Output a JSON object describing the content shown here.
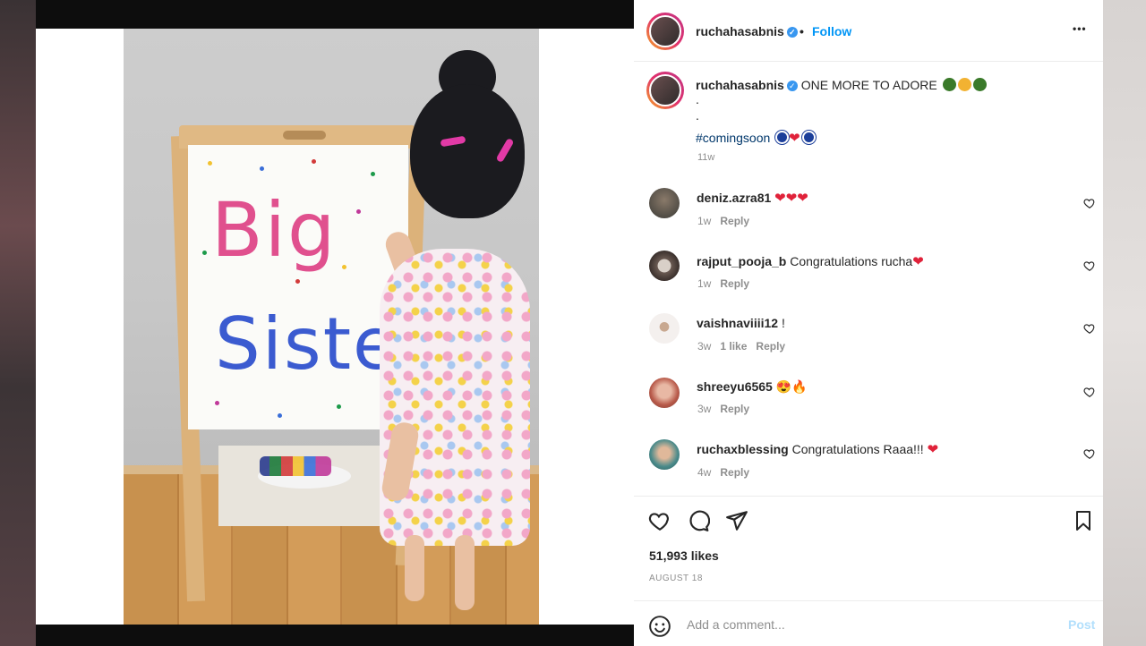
{
  "post": {
    "username": "ruchahasabnis",
    "follow_label": "Follow",
    "separator": "•",
    "more_label": "•••"
  },
  "caption": {
    "username": "ruchahasabnis",
    "text": "ONE MORE TO ADORE",
    "line2": ".",
    "line3": ".",
    "hashtag": "#comingsoon",
    "time": "11w"
  },
  "comments": [
    {
      "username": "deniz.azra81",
      "text": "",
      "emoji": "❤❤❤",
      "time": "1w",
      "likes": "",
      "reply": "Reply"
    },
    {
      "username": "rajput_pooja_b",
      "text": "Congratulations rucha",
      "emoji": "❤",
      "time": "1w",
      "likes": "",
      "reply": "Reply"
    },
    {
      "username": "vaishnaviiii12",
      "text": "!",
      "emoji": "",
      "time": "3w",
      "likes": "1 like",
      "reply": "Reply"
    },
    {
      "username": "shreeyu6565",
      "text": "",
      "emoji": "😍🔥",
      "time": "3w",
      "likes": "",
      "reply": "Reply"
    },
    {
      "username": "ruchaxblessing",
      "text": "Congratulations Raaa!!!",
      "emoji": "❤",
      "time": "4w",
      "likes": "",
      "reply": "Reply"
    }
  ],
  "stats": {
    "likes": "51,993 likes",
    "date": "AUGUST 18"
  },
  "add_comment": {
    "placeholder": "Add a comment...",
    "post_label": "Post"
  },
  "photo": {
    "board_line1": "Big",
    "board_line2": "Sister"
  },
  "colors": {
    "accent": "#0095f6",
    "heart": "#e0223a"
  }
}
